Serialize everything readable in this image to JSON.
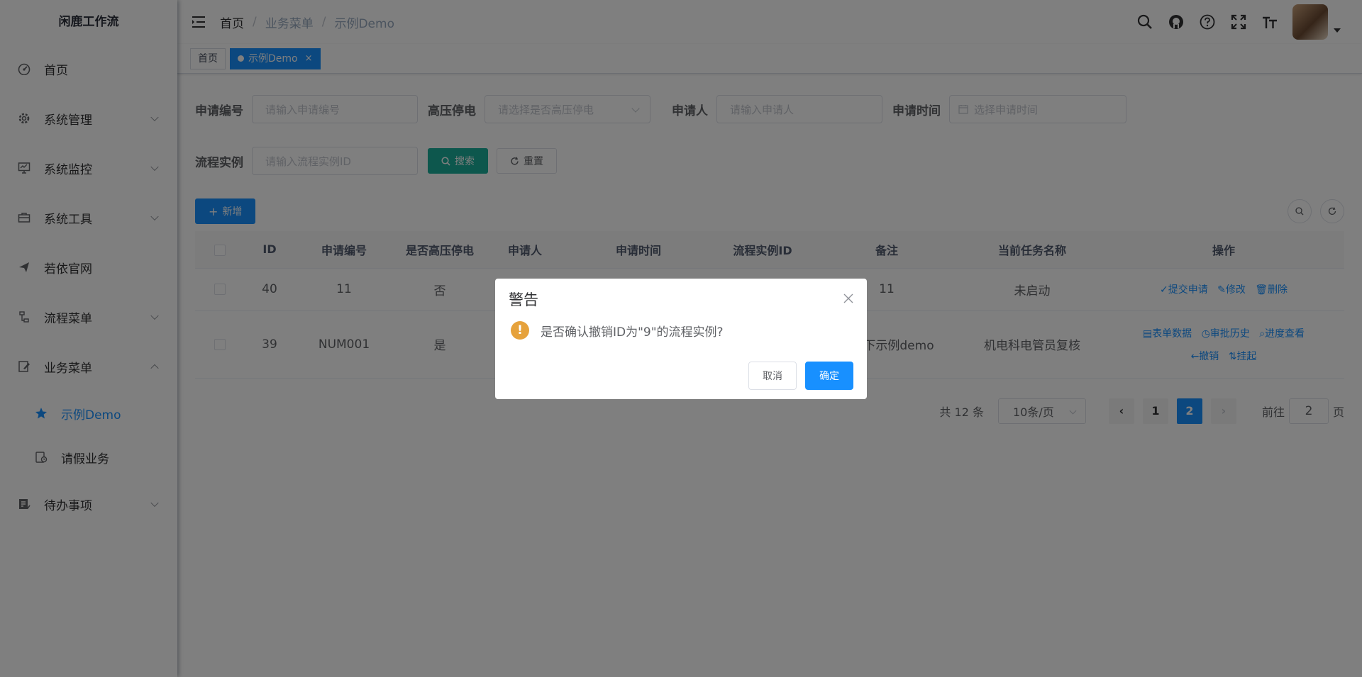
{
  "sidebar": {
    "logo": "闲鹿工作流",
    "items": [
      {
        "label": "首页",
        "icon": "dashboard-icon",
        "has_arrow": false
      },
      {
        "label": "系统管理",
        "icon": "gear-icon",
        "has_arrow": true
      },
      {
        "label": "系统监控",
        "icon": "monitor-icon",
        "has_arrow": true
      },
      {
        "label": "系统工具",
        "icon": "toolbox-icon",
        "has_arrow": true
      },
      {
        "label": "若依官网",
        "icon": "paper-plane-icon",
        "has_arrow": false
      },
      {
        "label": "流程菜单",
        "icon": "flow-icon",
        "has_arrow": true
      },
      {
        "label": "业务菜单",
        "icon": "edit-icon",
        "has_arrow": true,
        "expanded": true
      }
    ],
    "sub_items": [
      {
        "label": "示例Demo",
        "icon": "star-icon",
        "active": true
      },
      {
        "label": "请假业务",
        "icon": "leave-icon",
        "active": false
      }
    ],
    "last_item": {
      "label": "待办事项",
      "icon": "todo-icon"
    }
  },
  "navbar": {
    "breadcrumb": [
      "首页",
      "业务菜单",
      "示例Demo"
    ],
    "icons": [
      "search-icon",
      "github-icon",
      "question-icon",
      "fullscreen-icon",
      "font-size-icon"
    ]
  },
  "tags": {
    "home": "首页",
    "active": "示例Demo",
    "close": "×"
  },
  "search_form": {
    "apply_no_label": "申请编号",
    "apply_no_placeholder": "请输入申请编号",
    "hv_label": "高压停电",
    "hv_placeholder": "请选择是否高压停电",
    "applicant_label": "申请人",
    "applicant_placeholder": "请输入申请人",
    "time_label": "申请时间",
    "time_placeholder": "选择申请时间",
    "instance_label": "流程实例",
    "instance_placeholder": "请输入流程实例ID",
    "search_btn": "搜索",
    "reset_btn": "重置"
  },
  "toolbar": {
    "add_btn": "新增"
  },
  "table": {
    "headers": [
      "ID",
      "申请编号",
      "是否高压停电",
      "申请人",
      "申请时间",
      "流程实例ID",
      "备注",
      "当前任务名称",
      "操作"
    ],
    "rows": [
      {
        "id": "40",
        "apply_no": "11",
        "hv": "否",
        "applicant": "",
        "time": "",
        "instance": "",
        "remark": "11",
        "task": "未启动",
        "ops": [
          "提交申请",
          "修改",
          "删除"
        ]
      },
      {
        "id": "39",
        "apply_no": "NUM001",
        "hv": "是",
        "applicant": "",
        "time": "",
        "instance": "",
        "remark": "试一下示例demo",
        "task": "机电科电管员复核",
        "ops": [
          "表单数据",
          "审批历史",
          "进度查看",
          "撤销",
          "挂起"
        ]
      }
    ]
  },
  "pagination": {
    "total": "共 12 条",
    "page_size": "10条/页",
    "pages": [
      "1",
      "2"
    ],
    "current": "2",
    "goto_label": "前往",
    "goto_value": "2",
    "page_suffix": "页"
  },
  "dialog": {
    "title": "警告",
    "message": "是否确认撤销ID为\"9\"的流程实例?",
    "icon": "!",
    "cancel": "取消",
    "confirm": "确定"
  },
  "colors": {
    "primary": "#1890ff",
    "search_teal": "#1aae9b",
    "warning": "#e6a23c"
  }
}
